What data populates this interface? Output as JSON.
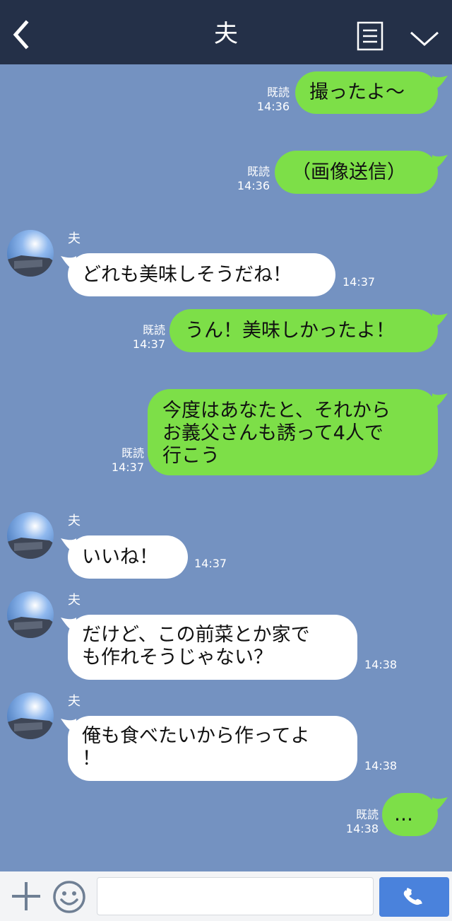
{
  "header": {
    "title": "夫",
    "back_icon": "chevron-left-icon",
    "menu_icon": "note-icon",
    "collapse_icon": "chevron-down-icon"
  },
  "colors": {
    "header_bg": "#243048",
    "chat_bg": "#7492c1",
    "my_bubble": "#7ddf48",
    "their_bubble": "#ffffff",
    "send_button": "#4a82dc"
  },
  "messages": [
    {
      "from": "me",
      "text": "撮ったよ〜",
      "read_label": "既読",
      "time": "14:36"
    },
    {
      "from": "me",
      "text": "（画像送信）",
      "read_label": "既読",
      "time": "14:36"
    },
    {
      "from": "them",
      "sender": "夫",
      "text": "どれも美味しそうだね！",
      "time": "14:37"
    },
    {
      "from": "me",
      "text": "うん！美味しかったよ！",
      "read_label": "既読",
      "time": "14:37"
    },
    {
      "from": "me",
      "text": "今度はあなたと、それから\nお義父さんも誘って4人で\n行こう",
      "read_label": "既読",
      "time": "14:37"
    },
    {
      "from": "them",
      "sender": "夫",
      "text": "いいね！",
      "time": "14:37"
    },
    {
      "from": "them",
      "sender": "夫",
      "text": "だけど、この前菜とか家で\nも作れそうじゃない？",
      "time": "14:38"
    },
    {
      "from": "them",
      "sender": "夫",
      "text": "俺も食べたいから作ってよ\n！",
      "time": "14:38"
    },
    {
      "from": "me",
      "text": "…",
      "read_label": "既読",
      "time": "14:38"
    }
  ],
  "composer": {
    "plus_icon": "plus-icon",
    "emoji_icon": "smiley-icon",
    "input_value": "",
    "call_icon": "phone-icon"
  }
}
